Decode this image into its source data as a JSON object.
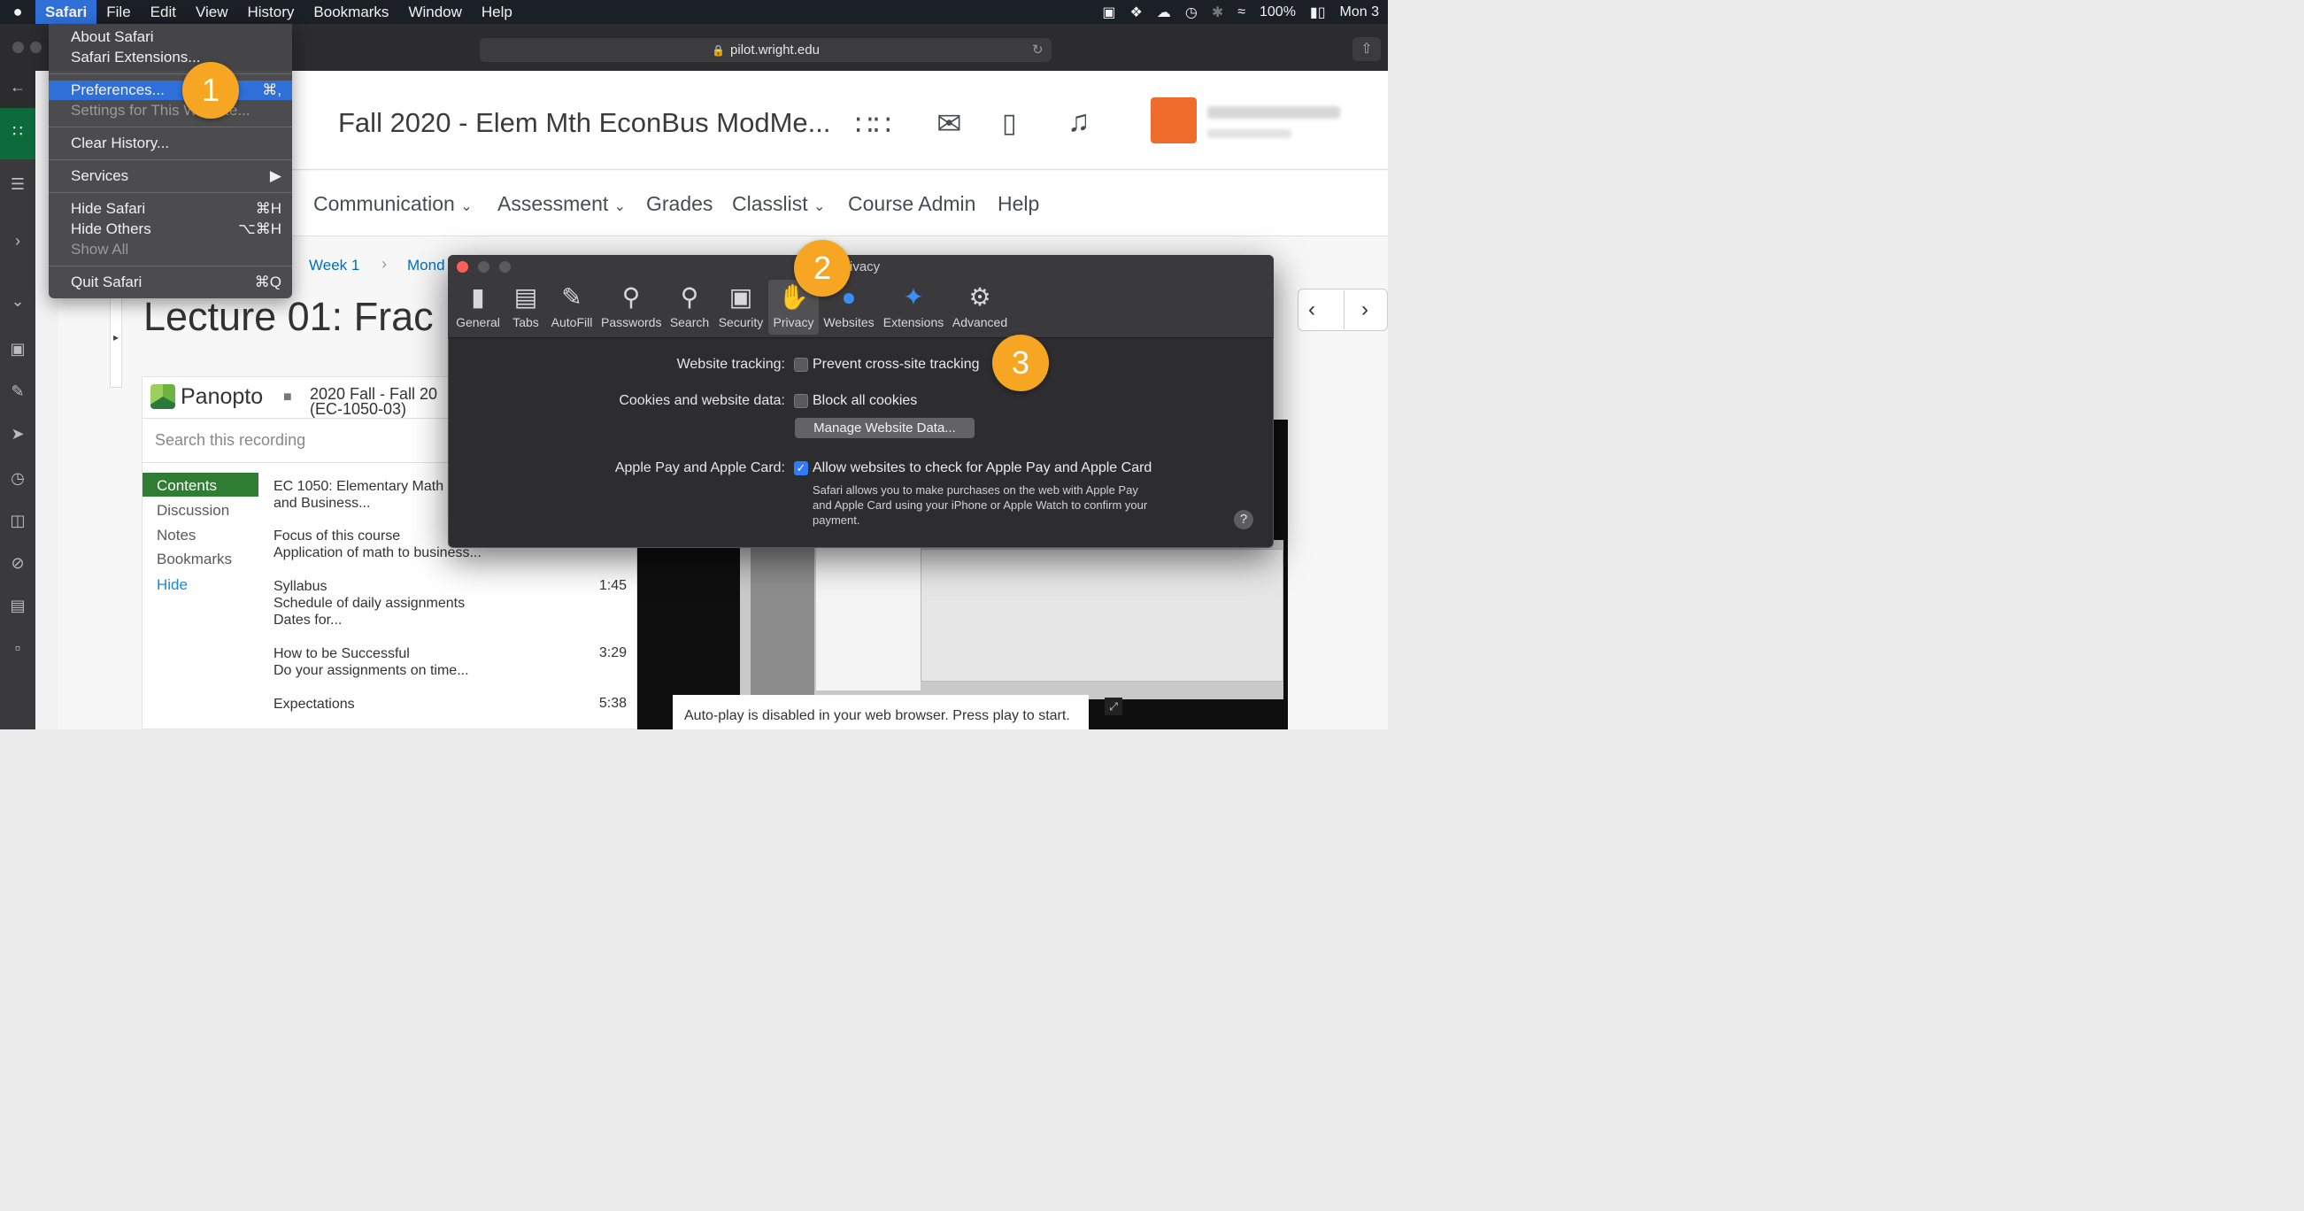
{
  "menubar": {
    "apple": "",
    "items": [
      "Safari",
      "File",
      "Edit",
      "View",
      "History",
      "Bookmarks",
      "Window",
      "Help"
    ],
    "battery": "100%",
    "clock": "Mon 3"
  },
  "browser": {
    "url": "pilot.wright.edu"
  },
  "safari_menu": {
    "about": "About Safari",
    "extensions": "Safari Extensions...",
    "preferences": "Preferences...",
    "preferences_shortcut": "⌘,",
    "settings_site": "Settings for This Website...",
    "clear_history": "Clear History...",
    "services": "Services",
    "hide_safari": "Hide Safari",
    "hide_safari_shortcut": "⌘H",
    "hide_others": "Hide Others",
    "hide_others_shortcut": "⌥⌘H",
    "show_all": "Show All",
    "quit": "Quit Safari",
    "quit_shortcut": "⌘Q"
  },
  "badges": [
    "1",
    "2",
    "3"
  ],
  "course": {
    "title": "Fall 2020 - Elem Mth EconBus ModMe...",
    "nav": [
      "Communication",
      "Assessment",
      "Grades",
      "Classlist",
      "Course Admin",
      "Help"
    ],
    "breadcrumb": [
      "Week 1",
      "Mond"
    ],
    "lecture_title": "Lecture 01: Frac"
  },
  "panopto": {
    "brand": "Panopto",
    "folder": "2020 Fall - Fall 20",
    "folder_sub": "(EC-1050-03)",
    "search_placeholder": "Search this recording",
    "side_tabs": [
      "Contents",
      "Discussion",
      "Notes",
      "Bookmarks",
      "Hide"
    ],
    "entries": [
      {
        "line1": "EC 1050: Elementary Math",
        "line2": "and Business...",
        "line3": "",
        "time": ""
      },
      {
        "line1": "Focus of this course",
        "line2": "Application of math to business...",
        "line3": "",
        "time": ""
      },
      {
        "line1": "Syllabus",
        "line2": "Schedule of daily assignments",
        "line3": "Dates for...",
        "time": "1:45"
      },
      {
        "line1": "How to be Successful",
        "line2": "Do your assignments on time...",
        "line3": "",
        "time": "3:29"
      },
      {
        "line1": "Expectations",
        "line2": "",
        "line3": "",
        "time": "5:38"
      }
    ],
    "autoplay": "Auto-play is disabled in your web browser. Press play to start."
  },
  "prefs": {
    "title_fragment": "ivacy",
    "tabs": [
      "General",
      "Tabs",
      "AutoFill",
      "Passwords",
      "Search",
      "Security",
      "Privacy",
      "Websites",
      "Extensions",
      "Advanced"
    ],
    "active_tab": "Privacy",
    "website_tracking_label": "Website tracking:",
    "prevent_tracking": "Prevent cross-site tracking",
    "prevent_tracking_checked": false,
    "cookies_label": "Cookies and website data:",
    "block_cookies": "Block all cookies",
    "block_cookies_checked": false,
    "manage_button": "Manage Website Data...",
    "applepay_label": "Apple Pay and Apple Card:",
    "applepay_option": "Allow websites to check for Apple Pay and Apple Card",
    "applepay_checked": true,
    "applepay_desc1": "Safari allows you to make purchases on the web with Apple Pay",
    "applepay_desc2": "and Apple Card using your iPhone or Apple Watch to confirm your",
    "applepay_desc3": "payment.",
    "help": "?"
  },
  "colors": {
    "menu_highlight": "#2e6fd8",
    "badge": "#f6a623",
    "link": "#006fbf",
    "check_on": "#2f7cf6"
  }
}
